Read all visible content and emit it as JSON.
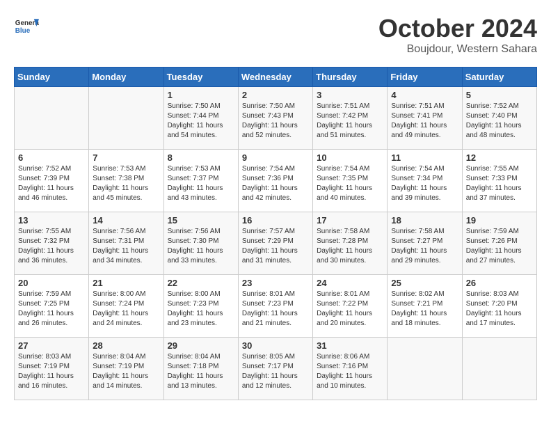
{
  "header": {
    "logo_general": "General",
    "logo_blue": "Blue",
    "month_title": "October 2024",
    "location": "Boujdour, Western Sahara"
  },
  "days_of_week": [
    "Sunday",
    "Monday",
    "Tuesday",
    "Wednesday",
    "Thursday",
    "Friday",
    "Saturday"
  ],
  "weeks": [
    [
      {
        "day": "",
        "info": ""
      },
      {
        "day": "",
        "info": ""
      },
      {
        "day": "1",
        "info": "Sunrise: 7:50 AM\nSunset: 7:44 PM\nDaylight: 11 hours\nand 54 minutes."
      },
      {
        "day": "2",
        "info": "Sunrise: 7:50 AM\nSunset: 7:43 PM\nDaylight: 11 hours\nand 52 minutes."
      },
      {
        "day": "3",
        "info": "Sunrise: 7:51 AM\nSunset: 7:42 PM\nDaylight: 11 hours\nand 51 minutes."
      },
      {
        "day": "4",
        "info": "Sunrise: 7:51 AM\nSunset: 7:41 PM\nDaylight: 11 hours\nand 49 minutes."
      },
      {
        "day": "5",
        "info": "Sunrise: 7:52 AM\nSunset: 7:40 PM\nDaylight: 11 hours\nand 48 minutes."
      }
    ],
    [
      {
        "day": "6",
        "info": "Sunrise: 7:52 AM\nSunset: 7:39 PM\nDaylight: 11 hours\nand 46 minutes."
      },
      {
        "day": "7",
        "info": "Sunrise: 7:53 AM\nSunset: 7:38 PM\nDaylight: 11 hours\nand 45 minutes."
      },
      {
        "day": "8",
        "info": "Sunrise: 7:53 AM\nSunset: 7:37 PM\nDaylight: 11 hours\nand 43 minutes."
      },
      {
        "day": "9",
        "info": "Sunrise: 7:54 AM\nSunset: 7:36 PM\nDaylight: 11 hours\nand 42 minutes."
      },
      {
        "day": "10",
        "info": "Sunrise: 7:54 AM\nSunset: 7:35 PM\nDaylight: 11 hours\nand 40 minutes."
      },
      {
        "day": "11",
        "info": "Sunrise: 7:54 AM\nSunset: 7:34 PM\nDaylight: 11 hours\nand 39 minutes."
      },
      {
        "day": "12",
        "info": "Sunrise: 7:55 AM\nSunset: 7:33 PM\nDaylight: 11 hours\nand 37 minutes."
      }
    ],
    [
      {
        "day": "13",
        "info": "Sunrise: 7:55 AM\nSunset: 7:32 PM\nDaylight: 11 hours\nand 36 minutes."
      },
      {
        "day": "14",
        "info": "Sunrise: 7:56 AM\nSunset: 7:31 PM\nDaylight: 11 hours\nand 34 minutes."
      },
      {
        "day": "15",
        "info": "Sunrise: 7:56 AM\nSunset: 7:30 PM\nDaylight: 11 hours\nand 33 minutes."
      },
      {
        "day": "16",
        "info": "Sunrise: 7:57 AM\nSunset: 7:29 PM\nDaylight: 11 hours\nand 31 minutes."
      },
      {
        "day": "17",
        "info": "Sunrise: 7:58 AM\nSunset: 7:28 PM\nDaylight: 11 hours\nand 30 minutes."
      },
      {
        "day": "18",
        "info": "Sunrise: 7:58 AM\nSunset: 7:27 PM\nDaylight: 11 hours\nand 29 minutes."
      },
      {
        "day": "19",
        "info": "Sunrise: 7:59 AM\nSunset: 7:26 PM\nDaylight: 11 hours\nand 27 minutes."
      }
    ],
    [
      {
        "day": "20",
        "info": "Sunrise: 7:59 AM\nSunset: 7:25 PM\nDaylight: 11 hours\nand 26 minutes."
      },
      {
        "day": "21",
        "info": "Sunrise: 8:00 AM\nSunset: 7:24 PM\nDaylight: 11 hours\nand 24 minutes."
      },
      {
        "day": "22",
        "info": "Sunrise: 8:00 AM\nSunset: 7:23 PM\nDaylight: 11 hours\nand 23 minutes."
      },
      {
        "day": "23",
        "info": "Sunrise: 8:01 AM\nSunset: 7:23 PM\nDaylight: 11 hours\nand 21 minutes."
      },
      {
        "day": "24",
        "info": "Sunrise: 8:01 AM\nSunset: 7:22 PM\nDaylight: 11 hours\nand 20 minutes."
      },
      {
        "day": "25",
        "info": "Sunrise: 8:02 AM\nSunset: 7:21 PM\nDaylight: 11 hours\nand 18 minutes."
      },
      {
        "day": "26",
        "info": "Sunrise: 8:03 AM\nSunset: 7:20 PM\nDaylight: 11 hours\nand 17 minutes."
      }
    ],
    [
      {
        "day": "27",
        "info": "Sunrise: 8:03 AM\nSunset: 7:19 PM\nDaylight: 11 hours\nand 16 minutes."
      },
      {
        "day": "28",
        "info": "Sunrise: 8:04 AM\nSunset: 7:19 PM\nDaylight: 11 hours\nand 14 minutes."
      },
      {
        "day": "29",
        "info": "Sunrise: 8:04 AM\nSunset: 7:18 PM\nDaylight: 11 hours\nand 13 minutes."
      },
      {
        "day": "30",
        "info": "Sunrise: 8:05 AM\nSunset: 7:17 PM\nDaylight: 11 hours\nand 12 minutes."
      },
      {
        "day": "31",
        "info": "Sunrise: 8:06 AM\nSunset: 7:16 PM\nDaylight: 11 hours\nand 10 minutes."
      },
      {
        "day": "",
        "info": ""
      },
      {
        "day": "",
        "info": ""
      }
    ]
  ]
}
